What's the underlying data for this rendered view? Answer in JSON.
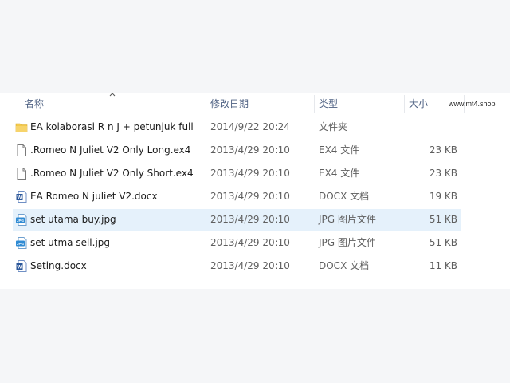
{
  "columns": {
    "name": "名称",
    "date": "修改日期",
    "type": "类型",
    "size": "大小"
  },
  "watermark": "www.mt4.shop",
  "files": [
    {
      "name": "EA kolaborasi R n J + petunjuk full",
      "date": "2014/9/22 20:24",
      "type": "文件夹",
      "size": "",
      "icon": "folder-icon",
      "selected": false
    },
    {
      "name": ".Romeo N Juliet V2 Only Long.ex4",
      "date": "2013/4/29 20:10",
      "type": "EX4 文件",
      "size": "23 KB",
      "icon": "file-icon",
      "selected": false
    },
    {
      "name": ".Romeo N Juliet V2 Only Short.ex4",
      "date": "2013/4/29 20:10",
      "type": "EX4 文件",
      "size": "23 KB",
      "icon": "file-icon",
      "selected": false
    },
    {
      "name": "EA Romeo N juliet V2.docx",
      "date": "2013/4/29 20:10",
      "type": "DOCX 文档",
      "size": "19 KB",
      "icon": "word-doc-icon",
      "selected": false
    },
    {
      "name": "set utama buy.jpg",
      "date": "2013/4/29 20:10",
      "type": "JPG 图片文件",
      "size": "51 KB",
      "icon": "jpg-image-icon",
      "selected": true
    },
    {
      "name": "set utma sell.jpg",
      "date": "2013/4/29 20:10",
      "type": "JPG 图片文件",
      "size": "51 KB",
      "icon": "jpg-image-icon",
      "selected": false
    },
    {
      "name": "Seting.docx",
      "date": "2013/4/29 20:10",
      "type": "DOCX 文档",
      "size": "11 KB",
      "icon": "word-doc-icon",
      "selected": false
    }
  ],
  "colors": {
    "selected_row": "#e5f1fb",
    "folder": "#f2c94c",
    "word_blue": "#2b579a",
    "jpg_blue": "#2f8bd4",
    "header_text": "#4d6082"
  }
}
